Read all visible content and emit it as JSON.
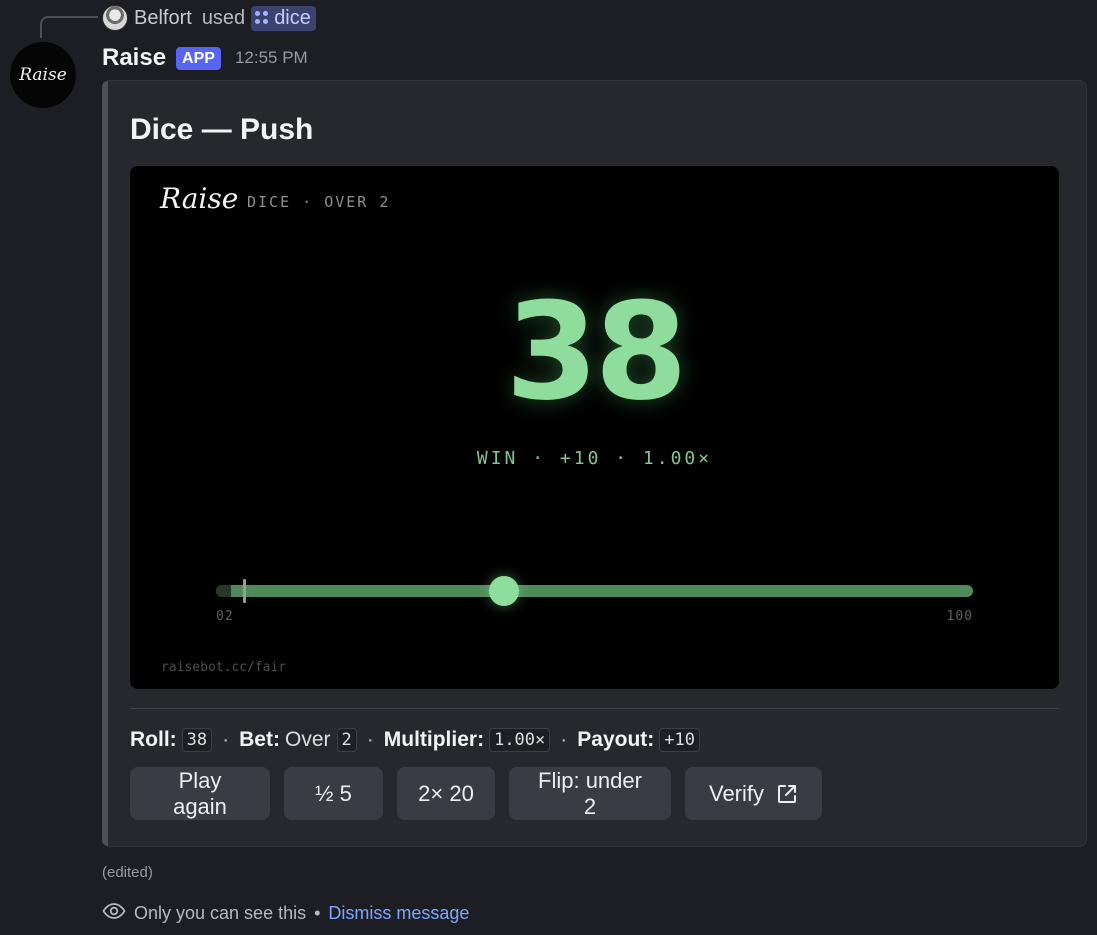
{
  "reply": {
    "user_name": "Belfort",
    "action_text": "used",
    "command_name": "dice"
  },
  "message": {
    "author_name": "Raise",
    "author_avatar_text": "Raise",
    "badge": "APP",
    "timestamp": "12:55 PM",
    "edited_label": "(edited)"
  },
  "embed": {
    "title": "Dice — Push",
    "card": {
      "logo": "Raise",
      "tag": "DICE · OVER 2",
      "roll": "38",
      "result_line": "WIN · +10 · 1.00×",
      "slider": {
        "min_label": "02",
        "max_label": "100",
        "min": 0,
        "max": 100,
        "threshold": 2,
        "roll_value": 38
      },
      "footer": "raisebot.cc/fair"
    },
    "stats": {
      "roll_label": "Roll:",
      "roll_value": "38",
      "bet_label": "Bet:",
      "bet_direction": "Over",
      "bet_value": "2",
      "multiplier_label": "Multiplier:",
      "multiplier_value": "1.00×",
      "payout_label": "Payout:",
      "payout_value": "+10",
      "separator": "·"
    },
    "buttons": {
      "play_again": "Play again",
      "half": "½ 5",
      "double": "2× 20",
      "flip": "Flip: under 2",
      "verify": "Verify"
    }
  },
  "footer": {
    "ephemeral_text": "Only you can see this",
    "separator": "•",
    "dismiss_link": "Dismiss message"
  },
  "colors": {
    "accent_green": "#8fdd9c",
    "badge_blue": "#5865f2",
    "link_blue": "#7ea6ff",
    "background": "#1d1e24",
    "embed_background": "#27282e"
  },
  "icons": [
    "command-icon",
    "external-link-icon",
    "eye-icon"
  ]
}
